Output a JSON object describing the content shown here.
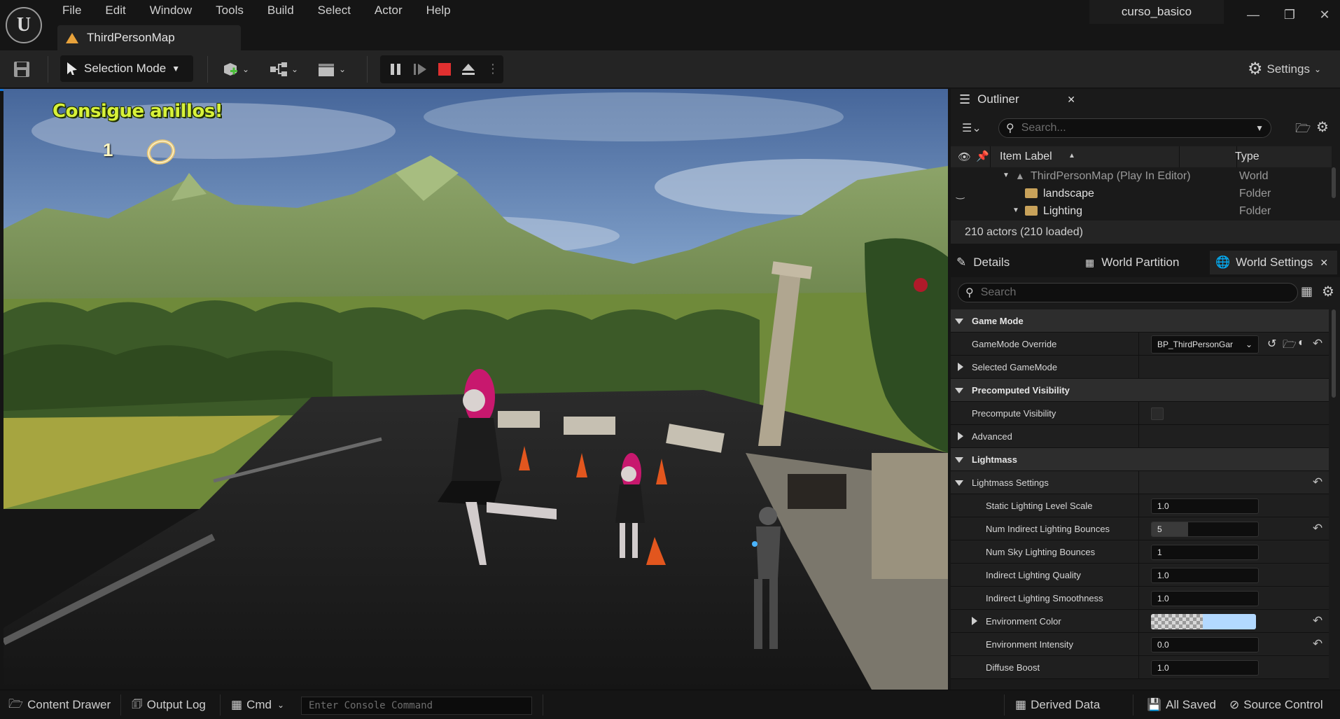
{
  "window": {
    "project_name": "curso_basico",
    "level_tab": "ThirdPersonMap"
  },
  "menu": [
    "File",
    "Edit",
    "Window",
    "Tools",
    "Build",
    "Select",
    "Actor",
    "Help"
  ],
  "toolbar": {
    "mode_label": "Selection Mode",
    "settings_label": "Settings"
  },
  "viewport": {
    "hud_title": "Consigue anillos!",
    "hud_count": "1"
  },
  "outliner": {
    "title": "Outliner",
    "search_placeholder": "Search...",
    "col_label": "Item Label",
    "col_type": "Type",
    "rows": [
      {
        "label": "ThirdPersonMap (Play In Editor)",
        "type": "World"
      },
      {
        "label": "landscape",
        "type": "Folder"
      },
      {
        "label": "Lighting",
        "type": "Folder"
      }
    ],
    "actors_count": "210 actors (210 loaded)"
  },
  "details": {
    "tabs": [
      "Details",
      "World Partition",
      "World Settings"
    ],
    "search_placeholder": "Search",
    "categories": {
      "game_mode": "Game Mode",
      "precomputed_visibility": "Precomputed Visibility",
      "lightmass": "Lightmass"
    },
    "rows": {
      "gamemode_override": {
        "label": "GameMode Override",
        "value": "BP_ThirdPersonGar"
      },
      "selected_gamemode": {
        "label": "Selected GameMode"
      },
      "precompute_visibility": {
        "label": "Precompute Visibility"
      },
      "advanced": {
        "label": "Advanced"
      },
      "lightmass_settings": {
        "label": "Lightmass Settings"
      },
      "static_scale": {
        "label": "Static Lighting Level Scale",
        "value": "1.0"
      },
      "num_indirect": {
        "label": "Num Indirect Lighting Bounces",
        "value": "5",
        "fill": 0.34
      },
      "num_sky": {
        "label": "Num Sky Lighting Bounces",
        "value": "1"
      },
      "indirect_quality": {
        "label": "Indirect Lighting Quality",
        "value": "1.0"
      },
      "indirect_smooth": {
        "label": "Indirect Lighting Smoothness",
        "value": "1.0"
      },
      "env_color": {
        "label": "Environment Color",
        "color": "#b3d9ff"
      },
      "env_intensity": {
        "label": "Environment Intensity",
        "value": "0.0"
      },
      "diffuse_boost": {
        "label": "Diffuse Boost",
        "value": "1.0"
      }
    }
  },
  "statusbar": {
    "content_drawer": "Content Drawer",
    "output_log": "Output Log",
    "cmd": "Cmd",
    "console_placeholder": "Enter Console Command",
    "derived_data": "Derived Data",
    "all_saved": "All Saved",
    "source_control": "Source Control"
  },
  "colors": {
    "accent": "#0f74d8",
    "stop": "#e03030",
    "hud_title": "#d8f23a"
  }
}
